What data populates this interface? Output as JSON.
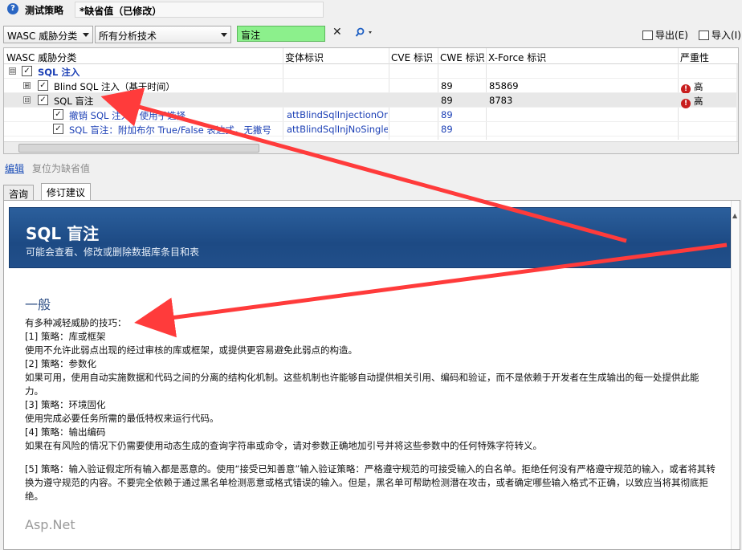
{
  "title": {
    "label": "测试策略",
    "value": "*缺省值（已修改）"
  },
  "toolbar": {
    "filter1": "WASC 威胁分类",
    "filter2": "所有分析技术",
    "search_value": "盲注",
    "clear_icon": "✕",
    "find_icon": "magnifier-icon",
    "export_label": "导出(E)",
    "import_label": "导入(I)"
  },
  "grid": {
    "headers": [
      "WASC 威胁分类",
      "变体标识",
      "CVE 标识",
      "CWE 标识",
      "X-Force 标识",
      "严重性"
    ],
    "rows": [
      {
        "name": "SQL 注入",
        "variant": "",
        "cve": "",
        "cwe": "",
        "xforce": "",
        "severity": "",
        "expander": "⊟",
        "checked": "✓"
      },
      {
        "name": "Blind SQL 注入（基于时间）",
        "variant": "",
        "cve": "",
        "cwe": "89",
        "xforce": "85869",
        "severity": "高",
        "expander": "⊞",
        "checked": "✓"
      },
      {
        "name": "SQL 盲注",
        "variant": "",
        "cve": "",
        "cwe": "89",
        "xforce": "8783",
        "severity": "高",
        "expander": "⊟",
        "checked": "✓"
      },
      {
        "name": "撤销 SQL 注入，使用子选择",
        "variant": "attBlindSqlInjectionOrd...",
        "cve": "",
        "cwe": "89",
        "xforce": "",
        "severity": "",
        "expander": "",
        "checked": "✓"
      },
      {
        "name": "SQL 盲注：附加布尔 True/False 表达式，无撇号",
        "variant": "attBlindSqlInjNoSingle...",
        "cve": "",
        "cwe": "89",
        "xforce": "",
        "severity": "",
        "expander": "",
        "checked": "✓"
      }
    ]
  },
  "actions": {
    "edit": "编辑",
    "reset": "复位为缺省值"
  },
  "tabs": [
    "咨询",
    "修订建议"
  ],
  "advisory": {
    "title": "SQL 盲注",
    "subtitle": "可能会查看、修改或删除数据库条目和表",
    "section": "一般",
    "intro": "有多种减轻威胁的技巧：",
    "items": [
      {
        "head": "[1] 策略：库或框架",
        "body": "使用不允许此弱点出现的经过审核的库或框架，或提供更容易避免此弱点的构造。"
      },
      {
        "head": "[2] 策略：参数化",
        "body": "如果可用，使用自动实施数据和代码之间的分离的结构化机制。这些机制也许能够自动提供相关引用、编码和验证，而不是依赖于开发者在生成输出的每一处提供此能力。"
      },
      {
        "head": "[3] 策略：环境固化",
        "body": "使用完成必要任务所需的最低特权来运行代码。"
      },
      {
        "head": "[4] 策略：输出编码",
        "body": "如果在有风险的情况下仍需要使用动态生成的查询字符串或命令，请对参数正确地加引号并将这些参数中的任何特殊字符转义。"
      },
      {
        "head": "",
        "body": "[5] 策略：输入验证假定所有输入都是恶意的。使用“接受已知善意”输入验证策略：严格遵守规范的可接受输入的白名单。拒绝任何没有严格遵守规范的输入，或者将其转换为遵守规范的内容。不要完全依赖于通过黑名单检测恶意或格式错误的输入。但是，黑名单可帮助检测潜在攻击，或者确定哪些输入格式不正确，以致应当将其彻底拒绝。"
      }
    ],
    "next_section": "Asp.Net"
  },
  "colors": {
    "banner": "#24548f",
    "search_bg": "#8cf08c",
    "arrow": "#ff3b3b",
    "severity": "#c81e1e"
  }
}
